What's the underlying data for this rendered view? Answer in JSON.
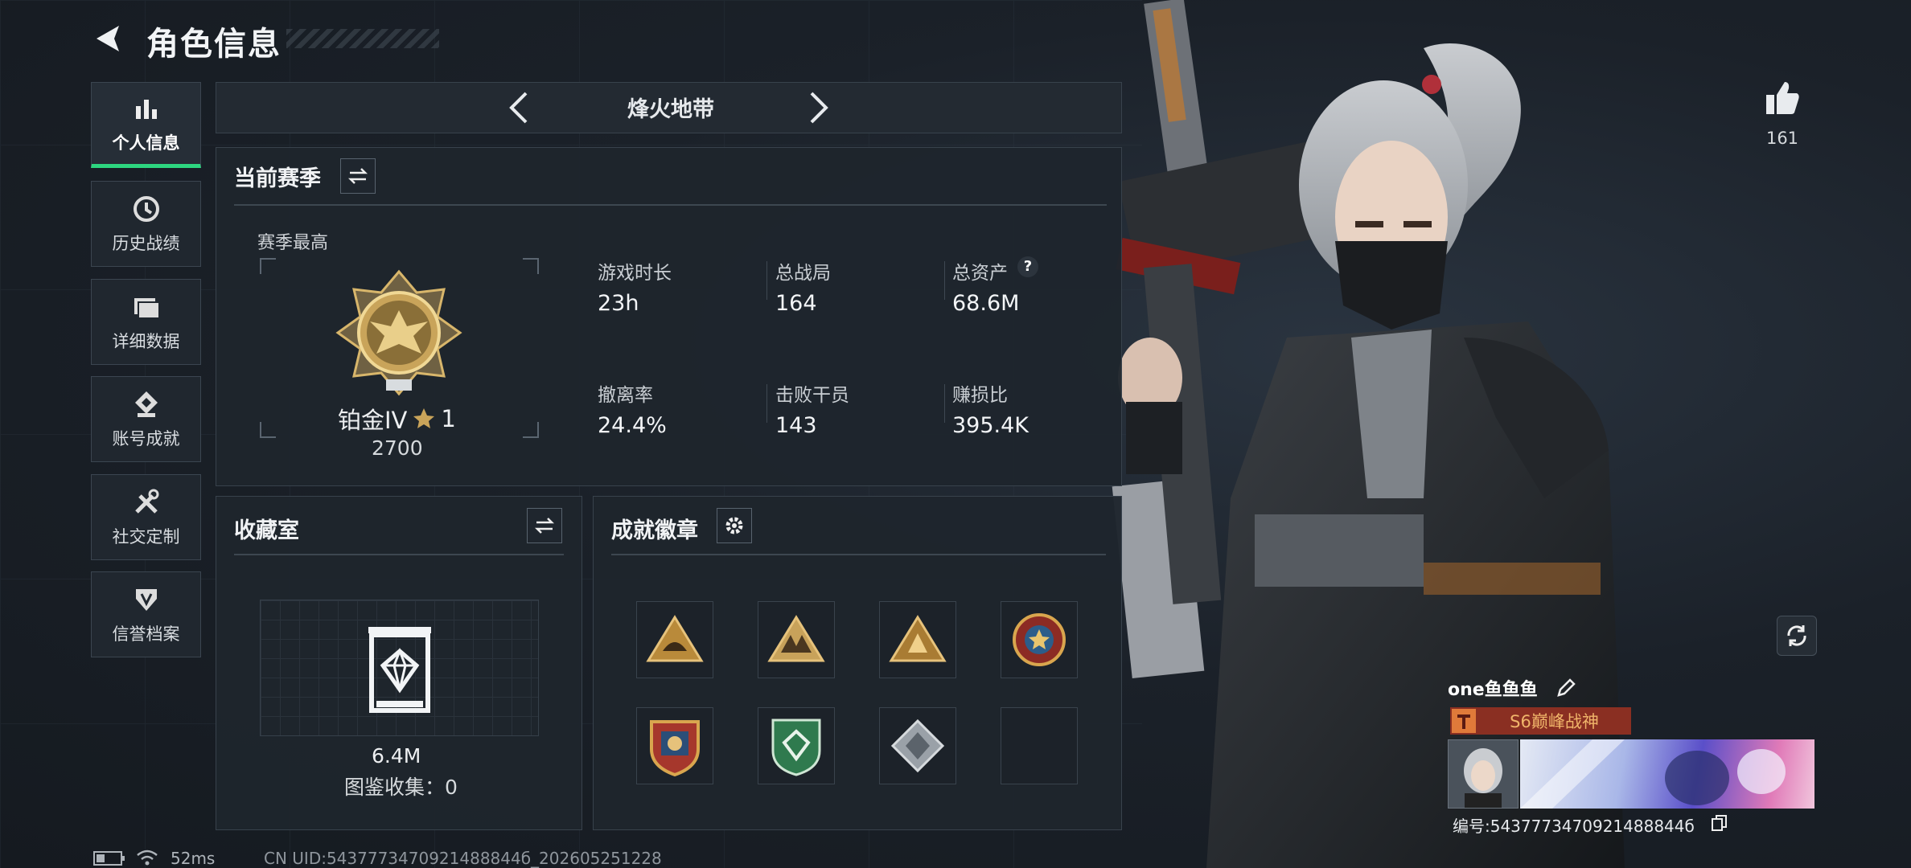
{
  "header": {
    "title": "角色信息"
  },
  "sidebar": {
    "items": [
      {
        "label": "个人信息",
        "icon": "bar-chart-icon",
        "active": true
      },
      {
        "label": "历史战绩",
        "icon": "clock-icon",
        "active": false
      },
      {
        "label": "详细数据",
        "icon": "folder-icon",
        "active": false
      },
      {
        "label": "账号成就",
        "icon": "achievement-icon",
        "active": false
      },
      {
        "label": "社交定制",
        "icon": "tools-icon",
        "active": false
      },
      {
        "label": "信誉档案",
        "icon": "shield-icon",
        "active": false
      }
    ]
  },
  "mode_selector": {
    "label": "烽火地带"
  },
  "season": {
    "title": "当前赛季",
    "highest_label": "赛季最高",
    "rank": "铂金IV",
    "stars": "1",
    "score": "2700",
    "stats": [
      {
        "label": "游戏时长",
        "value": "23h"
      },
      {
        "label": "总战局",
        "value": "164"
      },
      {
        "label": "总资产",
        "value": "68.6M",
        "help": "?"
      },
      {
        "label": "撤离率",
        "value": "24.4%"
      },
      {
        "label": "击败干员",
        "value": "143"
      },
      {
        "label": "赚损比",
        "value": "395.4K"
      }
    ]
  },
  "collection": {
    "title": "收藏室",
    "value": "6.4M",
    "caption": "图鉴收集：0"
  },
  "badges": {
    "title": "成就徽章"
  },
  "likes": {
    "count": "161"
  },
  "player": {
    "name": "one鱼鱼鱼",
    "title_tag": "S6巅峰战神",
    "id_line": "编号:5437773470921488844б"
  },
  "status_bar": {
    "ping": "52ms",
    "uid": "CN UID:5437773470921488844б_202605251228"
  },
  "colors": {
    "accent": "#2dd680",
    "title_tag_bg": "#8a2f22",
    "gold": "#c9a45a"
  }
}
